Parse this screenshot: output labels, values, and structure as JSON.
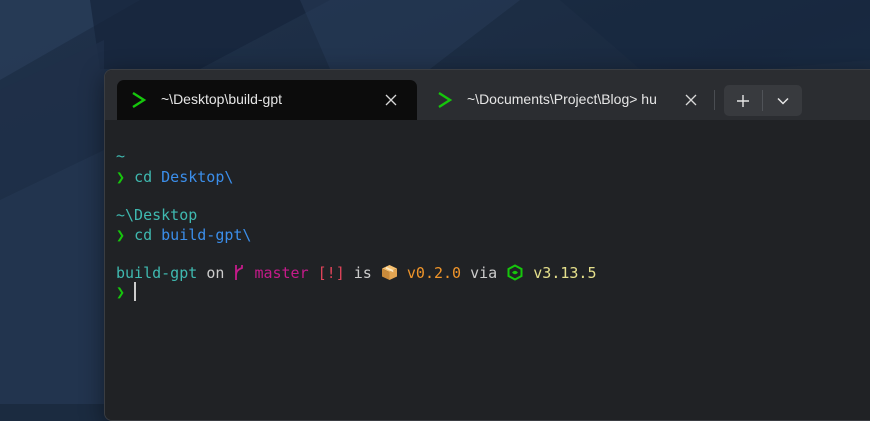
{
  "tabs": [
    {
      "title": "~\\Desktop\\build-gpt",
      "active": true,
      "icon": "terminal-prompt-icon"
    },
    {
      "title": "~\\Documents\\Project\\Blog> hu",
      "active": false,
      "icon": "terminal-prompt-icon"
    }
  ],
  "tab_controls": {
    "new_tab_icon": "plus-icon",
    "dropdown_icon": "chevron-down-icon"
  },
  "terminal": {
    "prompt_char": "❯",
    "block1": {
      "path": "~",
      "command": "cd",
      "argument": "Desktop\\"
    },
    "block2": {
      "path": "~\\Desktop",
      "command": "cd",
      "argument": "build-gpt\\"
    },
    "status_line": {
      "directory": "build-gpt",
      "on_word": "on",
      "branch_icon": "git-branch-icon",
      "branch": "master",
      "git_status": "[!]",
      "is_word": "is",
      "package_icon": "package-icon",
      "package_version": "v0.2.0",
      "via_word": "via",
      "runtime_icon": "node-icon",
      "runtime_version": "v3.13.5"
    }
  },
  "colors": {
    "path": "#3fb9b0",
    "prompt": "#16c60c",
    "argument": "#3b8eea",
    "branch": "#c51b8a",
    "git_status": "#e0445a",
    "package": "#f0952a",
    "runtime": "#e5e08c"
  }
}
